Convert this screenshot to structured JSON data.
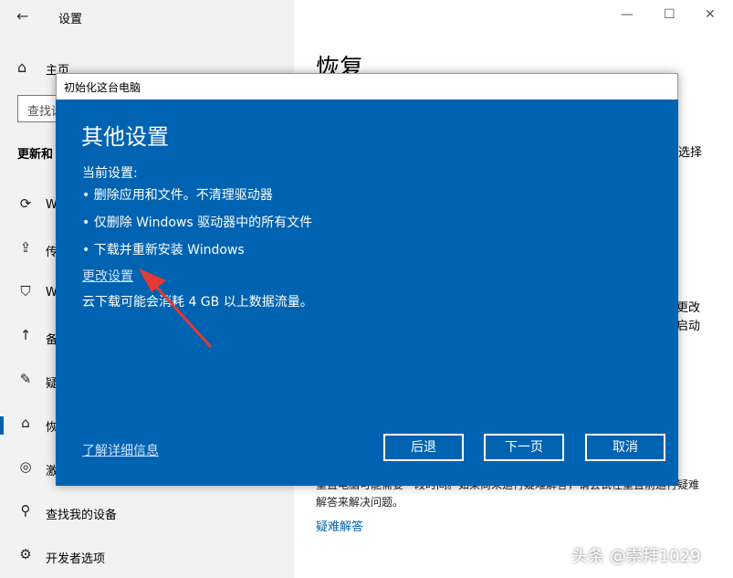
{
  "app": {
    "back_glyph": "←",
    "title": "设置",
    "minimize_glyph": "—",
    "maximize_glyph": "☐",
    "close_glyph": "✕"
  },
  "sidebar": {
    "home_label": "主页",
    "search_placeholder": "查找设",
    "section_title": "更新和",
    "items": [
      {
        "icon": "sync-icon",
        "glyph": "⟳",
        "label": "W"
      },
      {
        "icon": "upload-icon",
        "glyph": "⇪",
        "label": "传"
      },
      {
        "icon": "shield-icon",
        "glyph": "⛉",
        "label": "W"
      },
      {
        "icon": "backup-icon",
        "glyph": "↑",
        "label": "备"
      },
      {
        "icon": "wrench-icon",
        "glyph": "✎",
        "label": "疑"
      },
      {
        "icon": "recovery-icon",
        "glyph": "⌂",
        "label": "恢"
      },
      {
        "icon": "check-circle-icon",
        "glyph": "◎",
        "label": "激"
      },
      {
        "icon": "person-icon",
        "glyph": "⚲",
        "label": "查找我的设备"
      },
      {
        "icon": "developer-icon",
        "glyph": "⚙",
        "label": "开发者选项"
      }
    ]
  },
  "main": {
    "heading": "恢复",
    "side_text_1": "选择",
    "side_text_2": "更改",
    "side_text_3": "启动",
    "bottom_text": "重置电脑可能需要一段时间。如果尚未运行疑难解答，请尝试在重置前运行疑难解答来解决问题。",
    "troubleshoot_link": "疑难解答"
  },
  "dialog": {
    "title": "初始化这台电脑",
    "heading": "其他设置",
    "current_label": "当前设置:",
    "bullets": [
      "• 删除应用和文件。不清理驱动器",
      "• 仅删除 Windows 驱动器中的所有文件",
      "•  下载并重新安装 Windows"
    ],
    "change_link": "更改设置",
    "data_note": "云下载可能会消耗 4 GB 以上数据流量。",
    "learn_link": "了解详细信息",
    "buttons": {
      "back": "后退",
      "next": "下一页",
      "cancel": "取消"
    }
  },
  "colors": {
    "accent": "#0063b1",
    "arrow": "#e53935"
  },
  "watermark": "头条 @崇拜1029"
}
